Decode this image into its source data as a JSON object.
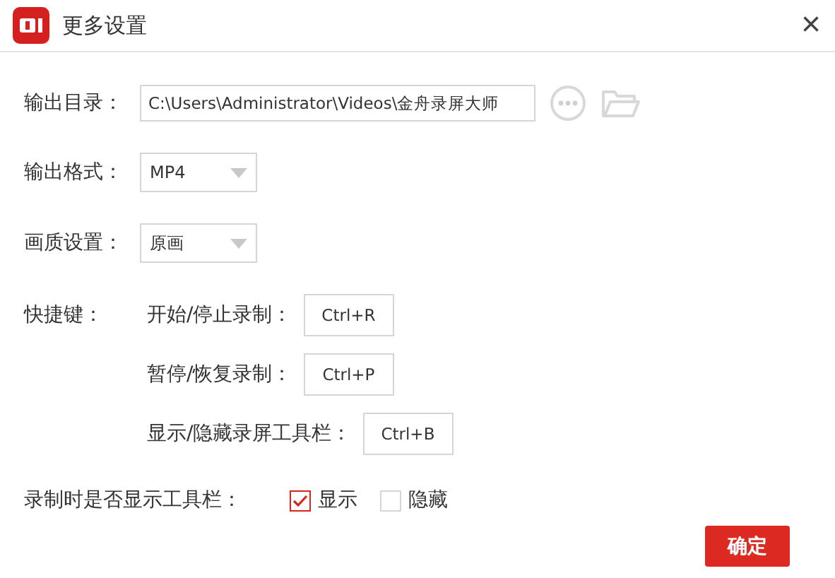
{
  "window": {
    "title": "更多设置",
    "close": "×"
  },
  "output_dir": {
    "label": "输出目录：",
    "value": "C:\\Users\\Administrator\\Videos\\金舟录屏大师"
  },
  "output_format": {
    "label": "输出格式：",
    "value": "MP4"
  },
  "quality": {
    "label": "画质设置：",
    "value": "原画"
  },
  "hotkeys": {
    "label": "快捷键：",
    "items": [
      {
        "label": "开始/停止录制：",
        "key": "Ctrl+R"
      },
      {
        "label": "暂停/恢复录制：",
        "key": "Ctrl+P"
      },
      {
        "label": "显示/隐藏录屏工具栏：",
        "key": "Ctrl+B"
      }
    ]
  },
  "toolbar_visibility": {
    "label": "录制时是否显示工具栏：",
    "options": [
      {
        "label": "显示",
        "checked": true
      },
      {
        "label": "隐藏",
        "checked": false
      }
    ]
  },
  "buttons": {
    "confirm": "确定"
  }
}
